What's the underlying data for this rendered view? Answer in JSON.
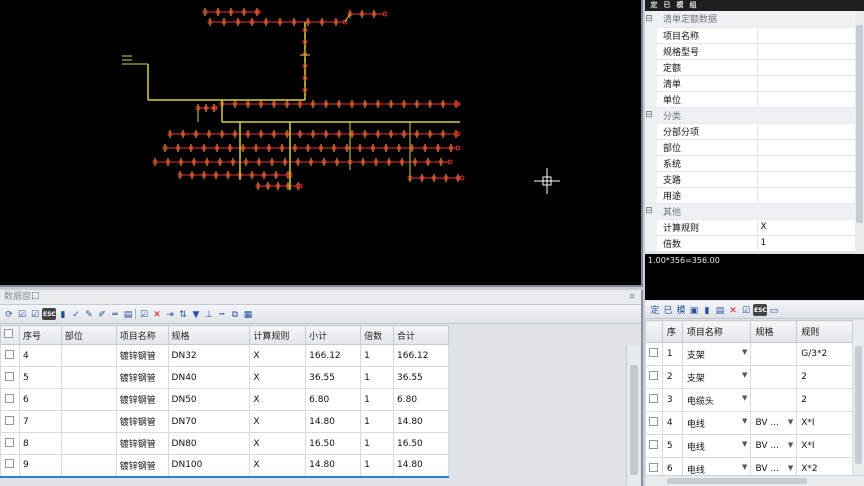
{
  "colors": {
    "pipe_yellow": "#d6d23a",
    "node_red": "#e03030",
    "canvas": "#000000"
  },
  "data_window": {
    "title": "数据窗口",
    "columns": [
      "序号",
      "部位",
      "项目名称",
      "规格",
      "计算规则",
      "小计",
      "倍数",
      "合计"
    ],
    "rows": [
      {
        "index": "4",
        "part": "",
        "name": "镀锌钢管",
        "spec": "DN32",
        "rule": "X",
        "subtotal": "166.12",
        "multiple": "1",
        "total": "166.12"
      },
      {
        "index": "5",
        "part": "",
        "name": "镀锌钢管",
        "spec": "DN40",
        "rule": "X",
        "subtotal": "36.55",
        "multiple": "1",
        "total": "36.55"
      },
      {
        "index": "6",
        "part": "",
        "name": "镀锌钢管",
        "spec": "DN50",
        "rule": "X",
        "subtotal": "6.80",
        "multiple": "1",
        "total": "6.80"
      },
      {
        "index": "7",
        "part": "",
        "name": "镀锌钢管",
        "spec": "DN70",
        "rule": "X",
        "subtotal": "14.80",
        "multiple": "1",
        "total": "14.80"
      },
      {
        "index": "8",
        "part": "",
        "name": "镀锌钢管",
        "spec": "DN80",
        "rule": "X",
        "subtotal": "16.50",
        "multiple": "1",
        "total": "16.50"
      },
      {
        "index": "9",
        "part": "",
        "name": "镀锌钢管",
        "spec": "DN100",
        "rule": "X",
        "subtotal": "14.80",
        "multiple": "1",
        "total": "14.80"
      }
    ]
  },
  "right_tabs": [
    "定",
    "已",
    "模",
    "组"
  ],
  "properties": {
    "cat1": "清单定额数据",
    "cat1_items": [
      {
        "key": "项目名称",
        "value": ""
      },
      {
        "key": "规格型号",
        "value": ""
      },
      {
        "key": "定额",
        "value": ""
      },
      {
        "key": "清单",
        "value": ""
      },
      {
        "key": "单位",
        "value": ""
      }
    ],
    "cat2": "分类",
    "cat2_items": [
      {
        "key": "分部分项",
        "value": ""
      },
      {
        "key": "部位",
        "value": ""
      },
      {
        "key": "系统",
        "value": ""
      },
      {
        "key": "支路",
        "value": ""
      },
      {
        "key": "用途",
        "value": ""
      }
    ],
    "cat3": "其他",
    "cat3_items": [
      {
        "key": "计算规则",
        "value": "X"
      },
      {
        "key": "倍数",
        "value": "1"
      }
    ]
  },
  "formula": "1.00*356=356.00",
  "sub_table": {
    "columns": [
      "序",
      "项目名称",
      "规格",
      "规则"
    ],
    "rows": [
      {
        "index": "1",
        "name": "支架",
        "spec": "",
        "rule": "G/3*2"
      },
      {
        "index": "2",
        "name": "支架",
        "spec": "",
        "rule": "2"
      },
      {
        "index": "3",
        "name": "电缆头",
        "spec": "",
        "rule": "2"
      },
      {
        "index": "4",
        "name": "电线",
        "spec": "BV ...",
        "rule": "X*I"
      },
      {
        "index": "5",
        "name": "电线",
        "spec": "BV ...",
        "rule": "X*I"
      },
      {
        "index": "6",
        "name": "电线",
        "spec": "BV ...",
        "rule": "X*2"
      }
    ]
  }
}
